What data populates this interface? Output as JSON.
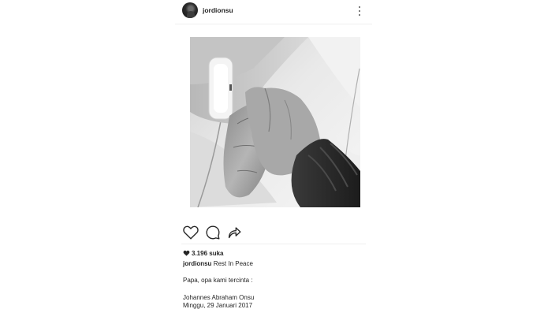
{
  "post": {
    "username": "jordionsu",
    "likes_text": "3.196 suka",
    "caption": {
      "author": "jordionsu",
      "text": "Rest In Peace"
    },
    "caption_lines": [
      "Papa, opa kami tercinta :",
      "Johannes Abraham Onsu",
      "Minggu, 29 Januari 2017"
    ]
  },
  "icons": {
    "more": "more-vertical-icon",
    "like": "heart-outline-icon",
    "comment": "comment-bubble-icon",
    "share": "share-arrow-icon",
    "likes_heart": "heart-filled-icon"
  },
  "colors": {
    "text": "#262626",
    "divider": "#efefef",
    "icon": "#262626"
  }
}
